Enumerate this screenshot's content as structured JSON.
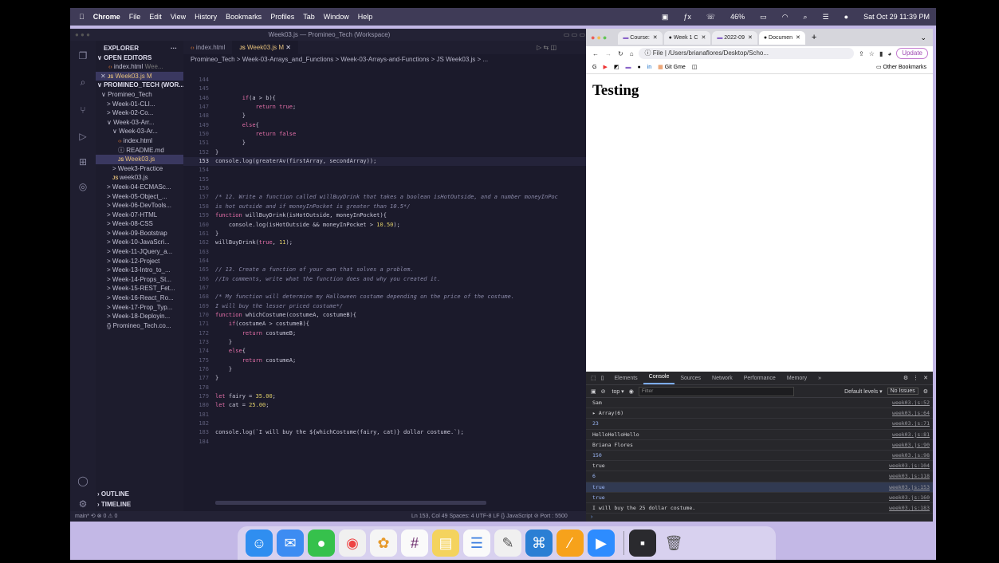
{
  "menubar": {
    "app": "Chrome",
    "items": [
      "File",
      "Edit",
      "View",
      "History",
      "Bookmarks",
      "Profiles",
      "Tab",
      "Window",
      "Help"
    ],
    "battery": "46%",
    "datetime": "Sat Oct 29  11:39 PM"
  },
  "vscode": {
    "window_title": "Week03.js — Promineo_Tech (Workspace)",
    "explorer": {
      "title": "EXPLORER",
      "open_editors_label": "OPEN EDITORS",
      "open_editors": [
        {
          "name": "index.html",
          "detail": "Wee..."
        },
        {
          "name": "Week03.js",
          "detail": "M"
        }
      ],
      "workspace_label": "PROMINEO_TECH (WOR...",
      "tree": [
        {
          "name": "Promineo_Tech",
          "indent": 1,
          "arrow": "∨"
        },
        {
          "name": "Week-01-CLI...",
          "indent": 2,
          "arrow": ">"
        },
        {
          "name": "Week-02-Co...",
          "indent": 2,
          "arrow": ">"
        },
        {
          "name": "Week-03-Arr...",
          "indent": 2,
          "arrow": "∨"
        },
        {
          "name": "Week-03-Ar...",
          "indent": 3,
          "arrow": "∨"
        },
        {
          "name": "index.html",
          "indent": 4,
          "arrow": ""
        },
        {
          "name": "README.md",
          "indent": 4,
          "arrow": ""
        },
        {
          "name": "Week03.js",
          "indent": 4,
          "arrow": ""
        },
        {
          "name": "Week3-Practice",
          "indent": 3,
          "arrow": ">"
        },
        {
          "name": "week03.js",
          "indent": 3,
          "arrow": ""
        },
        {
          "name": "Week-04-ECMASc...",
          "indent": 2,
          "arrow": ">"
        },
        {
          "name": "Week-05-Object_...",
          "indent": 2,
          "arrow": ">"
        },
        {
          "name": "Week-06-DevTools...",
          "indent": 2,
          "arrow": ">"
        },
        {
          "name": "Week-07-HTML",
          "indent": 2,
          "arrow": ">"
        },
        {
          "name": "Week-08-CSS",
          "indent": 2,
          "arrow": ">"
        },
        {
          "name": "Week-09-Bootstrap",
          "indent": 2,
          "arrow": ">"
        },
        {
          "name": "Week-10-JavaScri...",
          "indent": 2,
          "arrow": ">"
        },
        {
          "name": "Week-11-JQuery_a...",
          "indent": 2,
          "arrow": ">"
        },
        {
          "name": "Week-12-Project",
          "indent": 2,
          "arrow": ">"
        },
        {
          "name": "Week-13-Intro_to_...",
          "indent": 2,
          "arrow": ">"
        },
        {
          "name": "Week-14-Props_St...",
          "indent": 2,
          "arrow": ">"
        },
        {
          "name": "Week-15-REST_Fet...",
          "indent": 2,
          "arrow": ">"
        },
        {
          "name": "Week-16-React_Ro...",
          "indent": 2,
          "arrow": ">"
        },
        {
          "name": "Week-17-Prop_Typ...",
          "indent": 2,
          "arrow": ">"
        },
        {
          "name": "Week-18-Deployin...",
          "indent": 2,
          "arrow": ">"
        },
        {
          "name": "Promineo_Tech.co...",
          "indent": 2,
          "arrow": ""
        }
      ],
      "outline_label": "OUTLINE",
      "timeline_label": "TIMELINE"
    },
    "tabs": [
      {
        "label": "index.html",
        "active": false
      },
      {
        "label": "Week03.js M",
        "active": true
      }
    ],
    "breadcrumb": "Promineo_Tech > Week-03-Arrays_and_Functions > Week-03-Arrays-and-Functions > JS Week03.js > ...",
    "code": [
      {
        "n": "144",
        "t": ""
      },
      {
        "n": "145",
        "t": ""
      },
      {
        "n": "146",
        "t": "        if(a > b){"
      },
      {
        "n": "147",
        "t": "            return true;"
      },
      {
        "n": "148",
        "t": "        }"
      },
      {
        "n": "149",
        "t": "        else{"
      },
      {
        "n": "150",
        "t": "            return false"
      },
      {
        "n": "151",
        "t": "        }"
      },
      {
        "n": "152",
        "t": "}"
      },
      {
        "n": "153",
        "t": "console.log(greaterAv(firstArray, secondArray));"
      },
      {
        "n": "154",
        "t": ""
      },
      {
        "n": "155",
        "t": ""
      },
      {
        "n": "156",
        "t": ""
      },
      {
        "n": "157",
        "t": "/* 12. Write a function called willBuyDrink that takes a boolean isHotOutside, and a number moneyInPoc"
      },
      {
        "n": "158",
        "t": "is hot outside and if moneyInPocket is greater than 10.5*/"
      },
      {
        "n": "159",
        "t": "function willBuyDrink(isHotOutside, moneyInPocket){"
      },
      {
        "n": "160",
        "t": "    console.log(isHotOutside && moneyInPocket > 10.50);"
      },
      {
        "n": "161",
        "t": "}"
      },
      {
        "n": "162",
        "t": "willBuyDrink(true, 11);"
      },
      {
        "n": "163",
        "t": ""
      },
      {
        "n": "164",
        "t": ""
      },
      {
        "n": "165",
        "t": "// 13. Create a function of your own that solves a problem."
      },
      {
        "n": "166",
        "t": "//In comments, write what the function does and why you created it."
      },
      {
        "n": "167",
        "t": ""
      },
      {
        "n": "168",
        "t": "/* My function will determine my Halloween costume depending on the price of the costume."
      },
      {
        "n": "169",
        "t": "I will buy the lesser priced costume*/"
      },
      {
        "n": "170",
        "t": "function whichCostume(costumeA, costumeB){"
      },
      {
        "n": "171",
        "t": "    if(costumeA > costumeB){"
      },
      {
        "n": "172",
        "t": "        return costumeB;"
      },
      {
        "n": "173",
        "t": "    }"
      },
      {
        "n": "174",
        "t": "    else{"
      },
      {
        "n": "175",
        "t": "        return costumeA;"
      },
      {
        "n": "176",
        "t": "    }"
      },
      {
        "n": "177",
        "t": "}"
      },
      {
        "n": "178",
        "t": ""
      },
      {
        "n": "179",
        "t": "let fairy = 35.00;"
      },
      {
        "n": "180",
        "t": "let cat = 25.00;"
      },
      {
        "n": "181",
        "t": ""
      },
      {
        "n": "182",
        "t": ""
      },
      {
        "n": "183",
        "t": "console.log(`I will buy the ${whichCostume(fairy, cat)} dollar costume.`);"
      },
      {
        "n": "184",
        "t": ""
      }
    ],
    "current_line": "153",
    "status_left": "main*  ⟲  ⊗ 0 ⚠ 0",
    "status_right": "Ln 153, Col 49   Spaces: 4   UTF-8   LF   {} JavaScript   ⊘ Port : 5500"
  },
  "chrome": {
    "tabs": [
      {
        "label": "Course:",
        "active": false
      },
      {
        "label": "Week 1 C",
        "active": false
      },
      {
        "label": "2022-09",
        "active": false
      },
      {
        "label": "Documen",
        "active": true
      }
    ],
    "url": "File  |  /Users/brianaflores/Desktop/Scho...",
    "update_label": "Update",
    "bookmarks": [
      "Git Gme"
    ],
    "other_bookmarks": "Other Bookmarks",
    "page_heading": "Testing",
    "devtools": {
      "tabs": [
        "Elements",
        "Console",
        "Sources",
        "Network",
        "Performance",
        "Memory",
        "»"
      ],
      "active_tab": "Console",
      "context": "top ▾",
      "filter_placeholder": "Filter",
      "levels": "Default levels ▾",
      "issues": "No Issues",
      "rows": [
        {
          "val": "Sam",
          "src": "week03.js:52",
          "kind": "str"
        },
        {
          "val": "▸ Array(6)",
          "src": "week03.js:64",
          "kind": "str"
        },
        {
          "val": "23",
          "src": "week03.js:71",
          "kind": "num"
        },
        {
          "val": "HelloHelloHello",
          "src": "week03.js:81",
          "kind": "str"
        },
        {
          "val": "Briana Flores",
          "src": "week03.js:90",
          "kind": "str"
        },
        {
          "val": "150",
          "src": "week03.js:98",
          "kind": "num"
        },
        {
          "val": "true",
          "src": "week03.js:104",
          "kind": "str"
        },
        {
          "val": "6",
          "src": "week03.js:118",
          "kind": "num"
        },
        {
          "val": "true",
          "src": "week03.js:153",
          "kind": "bool"
        },
        {
          "val": "true",
          "src": "week03.js:160",
          "kind": "bool"
        },
        {
          "val": "I will buy the 25 dollar costume.",
          "src": "week03.js:183",
          "kind": "str"
        }
      ]
    }
  }
}
